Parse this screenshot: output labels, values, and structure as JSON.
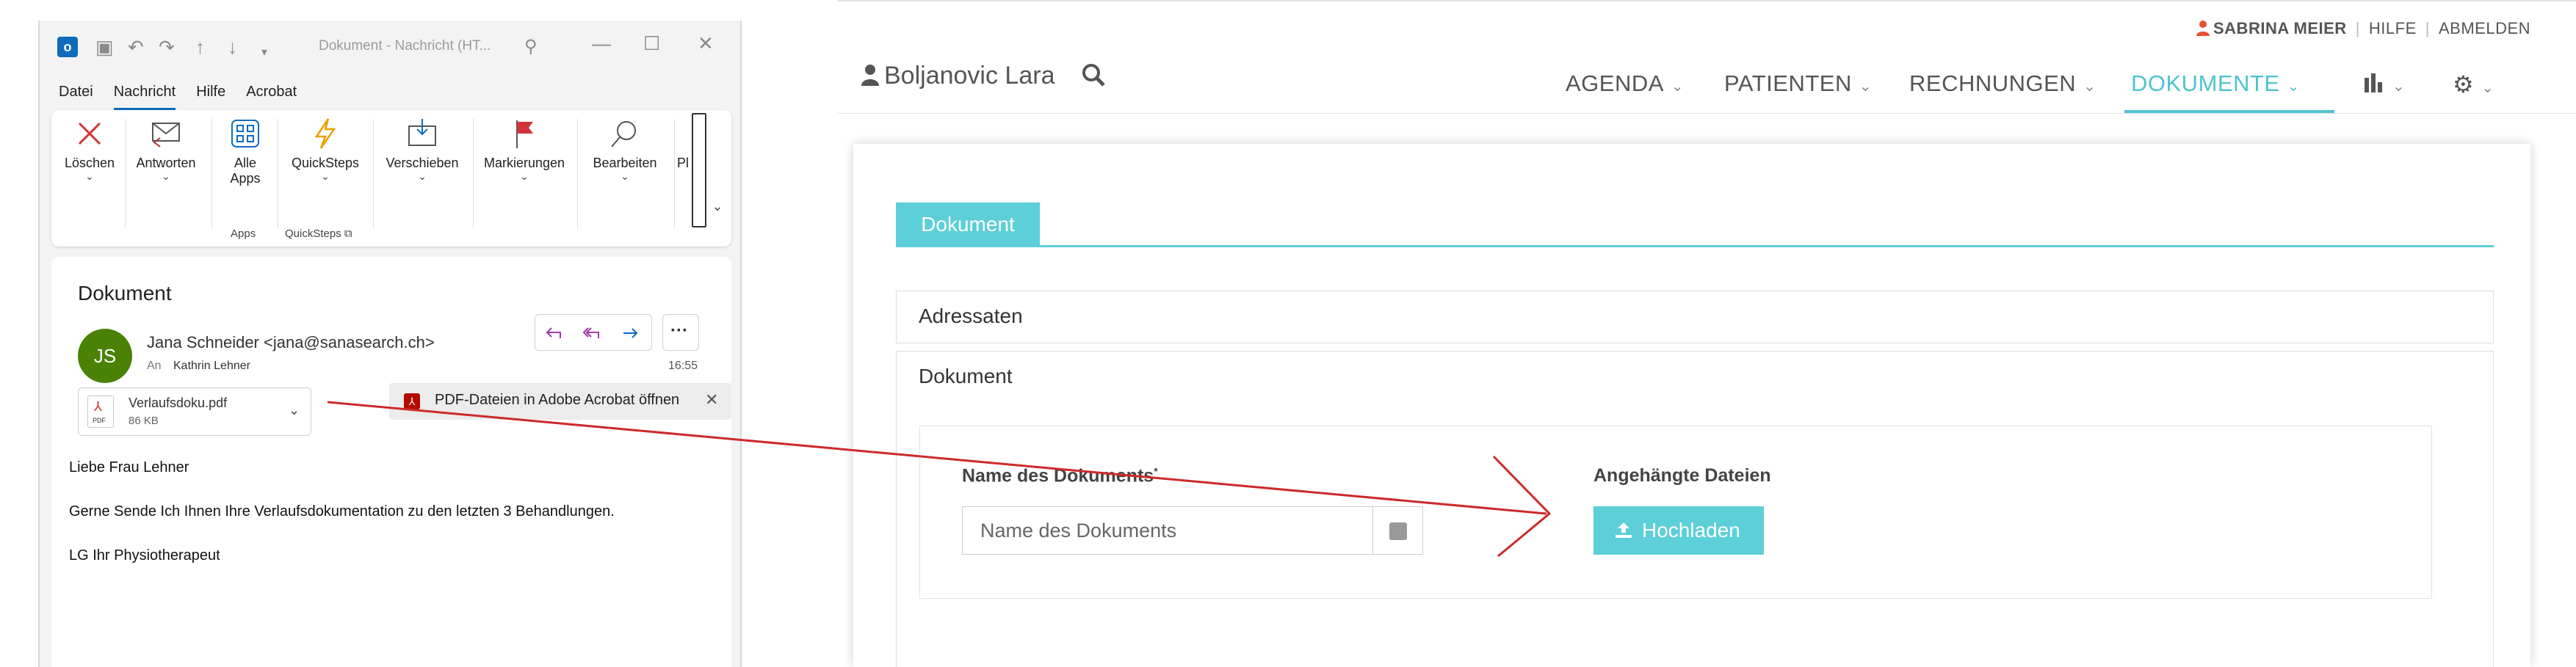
{
  "outlook": {
    "title": "Dokument - Nachricht (HT...",
    "menu": [
      "Datei",
      "Nachricht",
      "Hilfe",
      "Acrobat"
    ],
    "ribbon": {
      "delete": "Löschen",
      "reply": "Antworten",
      "apps_line1": "Alle",
      "apps_line2": "Apps",
      "quicksteps": "QuickSteps",
      "move": "Verschieben",
      "flags": "Markierungen",
      "edit": "Bearbeiten",
      "more": "Pl",
      "group_apps": "Apps",
      "group_quicksteps": "QuickSteps"
    },
    "mail": {
      "subject": "Dokument",
      "avatar_initials": "JS",
      "from": "Jana Schneider <jana@sanasearch.ch>",
      "to_label": "An",
      "to": "Kathrin Lehner",
      "time": "16:55",
      "attachment_name": "Verlaufsdoku.pdf",
      "attachment_size": "86 KB",
      "pdf_badge": "PDF",
      "acrobat_hint": "PDF-Dateien in Adobe Acrobat öffnen",
      "body": [
        "Liebe Frau Lehner",
        "Gerne Sende Ich Ihnen Ihre Verlaufsdokumentation zu den letzten 3 Behandlungen.",
        "LG Ihr Physiotherapeut"
      ]
    }
  },
  "webapp": {
    "user_name": "SABRINA MEIER",
    "help": "HILFE",
    "logout": "ABMELDEN",
    "patient": "Boljanovic Lara",
    "nav": [
      "AGENDA",
      "PATIENTEN",
      "RECHNUNGEN",
      "DOKUMENTE"
    ],
    "active_nav": "DOKUMENTE",
    "tab": "Dokument",
    "panel_addressees": "Adressaten",
    "panel_document": "Dokument",
    "field_label": "Name des Dokuments",
    "field_required_mark": "*",
    "field_placeholder": "Name des Dokuments",
    "attached_label": "Angehängte Dateien",
    "upload_button": "Hochladen"
  },
  "colors": {
    "accent": "#5ccfd8",
    "outlook_blue": "#0f6cbd",
    "avatar_green": "#498205",
    "arrow_red": "#cc2a2a",
    "user_icon_orange": "#e8502f"
  }
}
